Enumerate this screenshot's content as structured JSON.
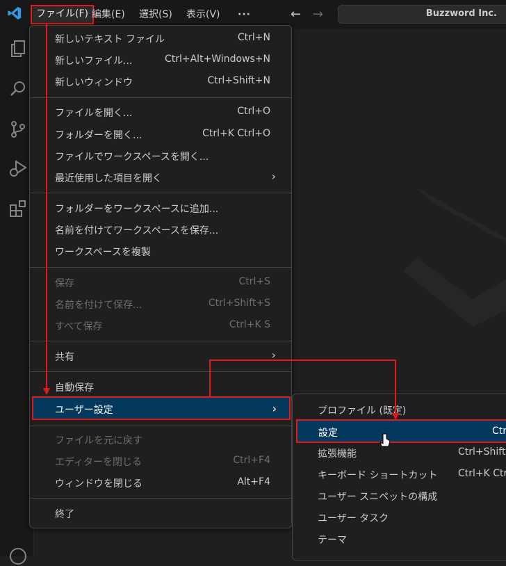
{
  "titlebar": {
    "menus": [
      "ファイル(F)",
      "編集(E)",
      "選択(S)",
      "表示(V)",
      "···"
    ],
    "search_text": "Buzzword Inc."
  },
  "file_menu": {
    "groups": [
      [
        {
          "label": "新しいテキスト ファイル",
          "key": "Ctrl+N"
        },
        {
          "label": "新しいファイル...",
          "key": "Ctrl+Alt+Windows+N"
        },
        {
          "label": "新しいウィンドウ",
          "key": "Ctrl+Shift+N"
        }
      ],
      [
        {
          "label": "ファイルを開く...",
          "key": "Ctrl+O"
        },
        {
          "label": "フォルダーを開く...",
          "key": "Ctrl+K Ctrl+O"
        },
        {
          "label": "ファイルでワークスペースを開く...",
          "key": ""
        },
        {
          "label": "最近使用した項目を開く",
          "key": ""
        }
      ],
      [
        {
          "label": "フォルダーをワークスペースに追加...",
          "key": ""
        },
        {
          "label": "名前を付けてワークスペースを保存...",
          "key": ""
        },
        {
          "label": "ワークスペースを複製",
          "key": ""
        }
      ],
      [
        {
          "label": "保存",
          "key": "Ctrl+S"
        },
        {
          "label": "名前を付けて保存...",
          "key": "Ctrl+Shift+S"
        },
        {
          "label": "すべて保存",
          "key": "Ctrl+K S"
        }
      ],
      [
        {
          "label": "共有",
          "key": ""
        }
      ],
      [
        {
          "label": "自動保存",
          "key": ""
        },
        {
          "label": "ユーザー設定",
          "key": ""
        }
      ],
      [
        {
          "label": "ファイルを元に戻す",
          "key": ""
        },
        {
          "label": "エディターを閉じる",
          "key": "Ctrl+F4"
        },
        {
          "label": "ウィンドウを閉じる",
          "key": "Alt+F4"
        }
      ],
      [
        {
          "label": "終了",
          "key": ""
        }
      ]
    ]
  },
  "prefs_submenu": {
    "items": [
      {
        "label": "プロファイル (既定)",
        "key": ""
      },
      {
        "label": "設定",
        "key": "Ctrl"
      },
      {
        "label": "拡張機能",
        "key": "Ctrl+Shift"
      },
      {
        "label": "キーボード ショートカット",
        "key": "Ctrl+K Ctrl"
      },
      {
        "label": "ユーザー スニペットの構成",
        "key": ""
      },
      {
        "label": "ユーザー タスク",
        "key": ""
      },
      {
        "label": "テーマ",
        "key": ""
      }
    ]
  },
  "colors": {
    "highlight": "#04395e",
    "annotation": "#e01a1a",
    "menu_bg": "#1f1f1f"
  }
}
